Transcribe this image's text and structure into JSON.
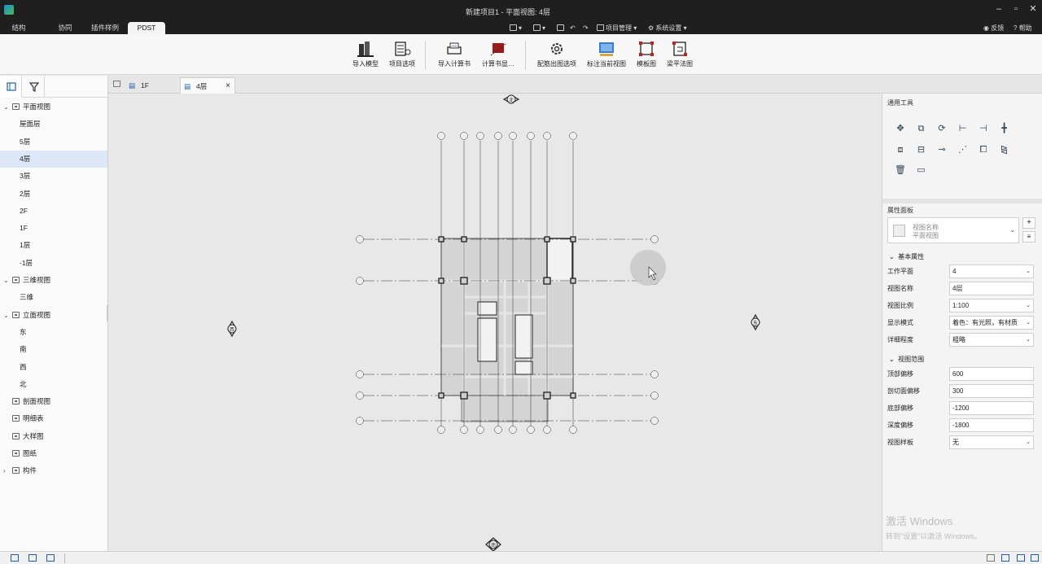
{
  "titlebar": {
    "title": "新建项目1 - 平面视图: 4层",
    "minimize": "–",
    "restore": "▫",
    "close": "✕"
  },
  "menubar": {
    "tabs": [
      "结构",
      "协同",
      "插件样例",
      "PDST"
    ],
    "active_tab": "PDST",
    "project_manage": "项目管理",
    "system_settings": "系统设置",
    "feedback": "反馈",
    "help": "帮助"
  },
  "ribbon": {
    "buttons": [
      {
        "label": "导入模型",
        "icon": "building-icon"
      },
      {
        "label": "项目选项",
        "icon": "options-icon"
      },
      {
        "label": "导入计算书",
        "icon": "import-calc-icon"
      },
      {
        "label": "计算书显…",
        "icon": "calc-display-icon"
      },
      {
        "label": "配筋出图选项",
        "icon": "gear-icon"
      },
      {
        "label": "标注当前视图",
        "icon": "annotate-icon"
      },
      {
        "label": "模板图",
        "icon": "template-icon"
      },
      {
        "label": "梁平法图",
        "icon": "beam-plan-icon"
      }
    ]
  },
  "tree": {
    "items": [
      {
        "label": "平面视图",
        "level": 0,
        "expanded": true
      },
      {
        "label": "屋面层",
        "level": 1
      },
      {
        "label": "5层",
        "level": 1
      },
      {
        "label": "4层",
        "level": 1,
        "selected": true
      },
      {
        "label": "3层",
        "level": 1
      },
      {
        "label": "2层",
        "level": 1
      },
      {
        "label": "2F",
        "level": 1
      },
      {
        "label": "1F",
        "level": 1
      },
      {
        "label": "1层",
        "level": 1
      },
      {
        "label": "-1层",
        "level": 1
      },
      {
        "label": "三维视图",
        "level": 0,
        "expanded": true
      },
      {
        "label": "三维",
        "level": 1
      },
      {
        "label": "立面视图",
        "level": 0,
        "expanded": true
      },
      {
        "label": "东",
        "level": 1
      },
      {
        "label": "南",
        "level": 1
      },
      {
        "label": "西",
        "level": 1
      },
      {
        "label": "北",
        "level": 1
      },
      {
        "label": "剖面视图",
        "level": 0
      },
      {
        "label": "明细表",
        "level": 0
      },
      {
        "label": "大样图",
        "level": 0
      },
      {
        "label": "图纸",
        "level": 0
      },
      {
        "label": "构件",
        "level": 0,
        "collapsed": true
      }
    ]
  },
  "doc_tabs": [
    {
      "label": "1F"
    },
    {
      "label": "4层",
      "active": true
    }
  ],
  "canvas": {
    "elev_markers": {
      "north": "北",
      "south": "南",
      "east": "东",
      "west": "西"
    },
    "axis_top": [
      "1",
      "2",
      "3",
      "4",
      "5",
      "6",
      "7",
      "8"
    ],
    "axis_left": [
      "A",
      "B",
      "C",
      "D",
      "E"
    ]
  },
  "right_panel": {
    "common_tools_title": "通用工具",
    "properties_title": "属性面板",
    "view_type_name": "视图名称",
    "view_type_sub": "平面视图",
    "groups": {
      "basic": "基本属性",
      "view_range": "视图范围"
    },
    "props": [
      {
        "label": "工作平面",
        "value": "4",
        "dropdown": true
      },
      {
        "label": "视图名称",
        "value": "4层",
        "dropdown": false
      },
      {
        "label": "视图比例",
        "value": "1:100",
        "dropdown": true
      },
      {
        "label": "显示模式",
        "value": "着色：有光照，有材质",
        "dropdown": true
      },
      {
        "label": "详细程度",
        "value": "粗略",
        "dropdown": true
      }
    ],
    "range_props": [
      {
        "label": "顶部偏移",
        "value": "600",
        "dropdown": false
      },
      {
        "label": "剖切面偏移",
        "value": "300",
        "dropdown": false
      },
      {
        "label": "底部偏移",
        "value": "-1200",
        "dropdown": false
      },
      {
        "label": "深度偏移",
        "value": "-1800",
        "dropdown": false
      },
      {
        "label": "视图样板",
        "value": "无",
        "dropdown": true
      }
    ]
  },
  "watermark": {
    "line1": "激活 Windows",
    "line2": "转到\"设置\"以激活 Windows。"
  },
  "colors": {
    "titlebar": "#1f1f1f",
    "selected_row": "#dce8f8",
    "canvas_bg": "#e8e8e8",
    "accent": "#1e5fa8"
  }
}
